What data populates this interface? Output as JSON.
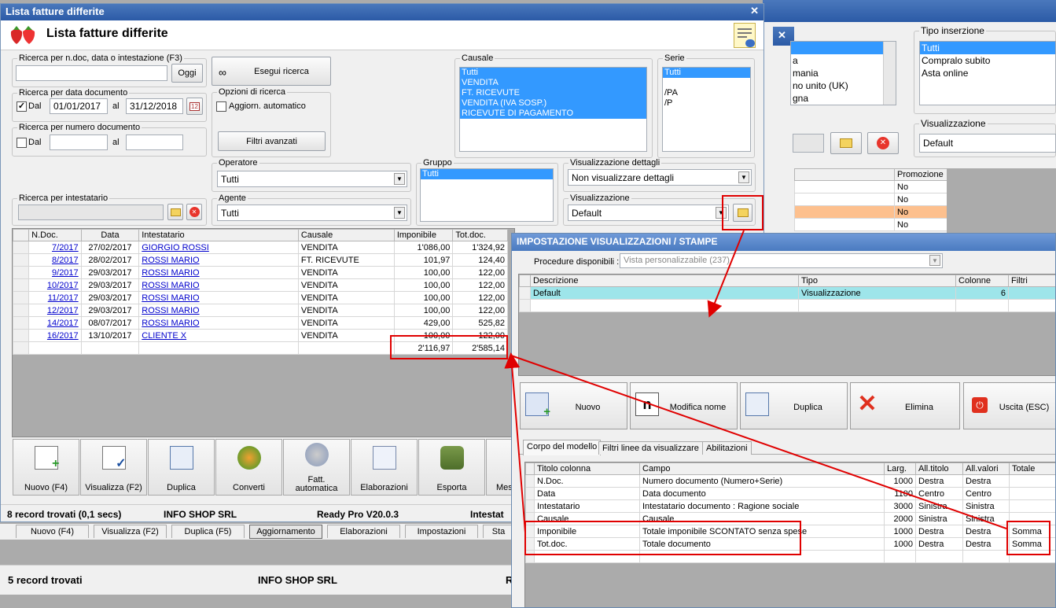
{
  "main_window": {
    "caption": "Lista fatture differite",
    "header_title": "Lista fatture differite"
  },
  "search_ndoc": {
    "legend": "Ricerca per n.doc, data o intestazione (F3)",
    "value": "",
    "oggi": "Oggi"
  },
  "search_btn": "Esegui ricerca",
  "search_data": {
    "legend": "Ricerca per data documento",
    "dal": "Dal",
    "from": "01/01/2017",
    "al": "al",
    "to": "31/12/2018",
    "checked": "✓",
    "calendar_badge": "12"
  },
  "options": {
    "legend": "Opzioni di ricerca",
    "auto": "Aggiorn. automatico",
    "filtri": "Filtri avanzati"
  },
  "search_num": {
    "legend": "Ricerca per numero documento",
    "dal": "Dal",
    "al": "al"
  },
  "causale": {
    "legend": "Causale",
    "items": [
      "Tutti",
      "VENDITA",
      "FT. RICEVUTE",
      "VENDITA (IVA SOSP.)",
      "RICEVUTE DI PAGAMENTO"
    ]
  },
  "serie": {
    "legend": "Serie",
    "items": [
      "Tutti",
      "",
      "/PA",
      "/P"
    ]
  },
  "operatore": {
    "legend": "Operatore",
    "value": "Tutti"
  },
  "gruppo": {
    "legend": "Gruppo",
    "value": "Tutti"
  },
  "vis_dettagli": {
    "legend": "Visualizzazione dettagli",
    "value": "Non visualizzare dettagli"
  },
  "intestatario": {
    "legend": "Ricerca per intestatario"
  },
  "agente": {
    "legend": "Agente",
    "value": "Tutti"
  },
  "visualizzazione": {
    "legend": "Visualizzazione",
    "value": "Default"
  },
  "grid": {
    "headers": [
      "N.Doc.",
      "Data",
      "Intestatario",
      "Causale",
      "Imponibile",
      "Tot.doc."
    ],
    "rows": [
      {
        "ndoc": "7/2017",
        "data": "27/02/2017",
        "intest": "GIORGIO ROSSI",
        "causale": "VENDITA",
        "imp": "1'086,00",
        "tot": "1'324,92"
      },
      {
        "ndoc": "8/2017",
        "data": "28/02/2017",
        "intest": "ROSSI MARIO",
        "causale": "FT. RICEVUTE",
        "imp": "101,97",
        "tot": "124,40"
      },
      {
        "ndoc": "9/2017",
        "data": "29/03/2017",
        "intest": "ROSSI MARIO",
        "causale": "VENDITA",
        "imp": "100,00",
        "tot": "122,00"
      },
      {
        "ndoc": "10/2017",
        "data": "29/03/2017",
        "intest": "ROSSI MARIO",
        "causale": "VENDITA",
        "imp": "100,00",
        "tot": "122,00"
      },
      {
        "ndoc": "11/2017",
        "data": "29/03/2017",
        "intest": "ROSSI MARIO",
        "causale": "VENDITA",
        "imp": "100,00",
        "tot": "122,00"
      },
      {
        "ndoc": "12/2017",
        "data": "29/03/2017",
        "intest": "ROSSI MARIO",
        "causale": "VENDITA",
        "imp": "100,00",
        "tot": "122,00"
      },
      {
        "ndoc": "14/2017",
        "data": "08/07/2017",
        "intest": "ROSSI MARIO",
        "causale": "VENDITA",
        "imp": "429,00",
        "tot": "525,82"
      },
      {
        "ndoc": "16/2017",
        "data": "13/10/2017",
        "intest": "CLIENTE X",
        "causale": "VENDITA",
        "imp": "100,00",
        "tot": "122,00"
      }
    ],
    "totals": {
      "imp": "2'116,97",
      "tot": "2'585,14"
    }
  },
  "toolbar": [
    "Nuovo (F4)",
    "Visualizza (F2)",
    "Duplica",
    "Converti",
    "Fatt. automatica",
    "Elaborazioni",
    "Esporta",
    "Mes"
  ],
  "status1": {
    "records": "8 record trovati (0,1 secs)",
    "company": "INFO SHOP SRL",
    "version": "Ready Pro V20.0.3",
    "extra": "Intestat"
  },
  "back": {
    "tipo_inserzione": {
      "legend": "Tipo inserzione",
      "items": [
        "Tutti",
        "Compralo subito",
        "Asta online"
      ]
    },
    "country_items": [
      "a",
      "mania",
      "no unito (UK)",
      "gna"
    ],
    "visualizzazione": {
      "legend": "Visualizzazione",
      "value": "Default"
    },
    "promo_header": "Promozione",
    "promo_rows": [
      "No",
      "No",
      "No",
      "No"
    ],
    "tabs": [
      "Nuovo (F4)",
      "Visualizza (F2)",
      "Duplica (F5)",
      "Aggiornamento",
      "Elaborazioni",
      "Impostazioni",
      "Sta"
    ],
    "status": {
      "records": "5 record trovati",
      "company": "INFO SHOP SRL",
      "extra": "R"
    }
  },
  "dialog": {
    "caption": "IMPOSTAZIONE VISUALIZZAZIONI / STAMPE",
    "proc_label": "Procedure disponibili :",
    "proc_value": "Vista personalizzabile (237)",
    "list_headers": [
      "Descrizione",
      "Tipo",
      "Colonne",
      "Filtri"
    ],
    "list_row": {
      "desc": "Default",
      "tipo": "Visualizzazione",
      "col": "6"
    },
    "buttons": [
      "Nuovo",
      "Modifica nome",
      "Duplica",
      "Elimina",
      "Uscita (ESC)"
    ],
    "tabs": [
      "Corpo del modello",
      "Filtri linee da visualizzare",
      "Abilitazioni"
    ],
    "col_headers": [
      "Titolo colonna",
      "Campo",
      "Larg.",
      "All.titolo",
      "All.valori",
      "Totale"
    ],
    "col_rows": [
      {
        "t": "N.Doc.",
        "c": "Numero documento (Numero+Serie)",
        "l": "1000",
        "at": "Destra",
        "av": "Destra",
        "tot": ""
      },
      {
        "t": "Data",
        "c": "Data documento",
        "l": "1100",
        "at": "Centro",
        "av": "Centro",
        "tot": ""
      },
      {
        "t": "Intestatario",
        "c": "Intestatario documento : Ragione sociale",
        "l": "3000",
        "at": "Sinistra",
        "av": "Sinistra",
        "tot": ""
      },
      {
        "t": "Causale",
        "c": "Causale",
        "l": "2000",
        "at": "Sinistra",
        "av": "Sinistra",
        "tot": ""
      },
      {
        "t": "Imponibile",
        "c": "Totale imponibile SCONTATO senza spese",
        "l": "1000",
        "at": "Destra",
        "av": "Destra",
        "tot": "Somma"
      },
      {
        "t": "Tot.doc.",
        "c": "Totale documento",
        "l": "1000",
        "at": "Destra",
        "av": "Destra",
        "tot": "Somma"
      }
    ]
  },
  "colors": {
    "annotation": "#e00000",
    "selection": "#3399ff",
    "titlebar": "#2b5aa6"
  }
}
